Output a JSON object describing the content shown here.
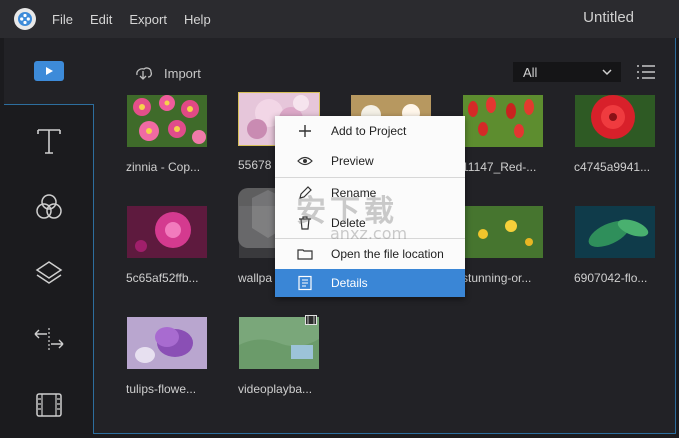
{
  "window": {
    "title": "Untitled"
  },
  "menu": [
    {
      "label": "File"
    },
    {
      "label": "Edit"
    },
    {
      "label": "Export"
    },
    {
      "label": "Help"
    }
  ],
  "sidebar": {
    "items": [
      {
        "icon": "media-icon",
        "active": true
      },
      {
        "icon": "text-icon"
      },
      {
        "icon": "filters-icon"
      },
      {
        "icon": "overlays-icon"
      },
      {
        "icon": "transitions-icon"
      },
      {
        "icon": "elements-icon"
      }
    ]
  },
  "toolbar": {
    "import_label": "Import",
    "filter_value": "All"
  },
  "media": [
    {
      "caption": "zinnia - Cop...",
      "scene": "pink-flowers"
    },
    {
      "caption": "55678",
      "scene": "pink-blossom",
      "selected": true
    },
    {
      "caption": "",
      "scene": "white-flowers"
    },
    {
      "caption": "11147_Red-...",
      "scene": "red-tulips"
    },
    {
      "caption": "c4745a9941...",
      "scene": "red-flower"
    },
    {
      "caption": "5c65af52ffb...",
      "scene": "purple-flower"
    },
    {
      "caption": "wallpa",
      "scene": "wallpaper"
    },
    {
      "caption": "",
      "scene": "hidden"
    },
    {
      "caption": "stunning-or...",
      "scene": "yellow-field"
    },
    {
      "caption": "6907042-flo...",
      "scene": "green-plant"
    },
    {
      "caption": "tulips-flowe...",
      "scene": "purple-tulips"
    },
    {
      "caption": "videoplayba...",
      "scene": "video-landscape",
      "video": true
    }
  ],
  "context_menu": {
    "items": [
      {
        "label": "Add to Project",
        "icon": "plus-icon"
      },
      {
        "label": "Preview",
        "icon": "eye-icon"
      },
      {
        "label": "Rename",
        "icon": "pencil-icon"
      },
      {
        "label": "Delete",
        "icon": "trash-icon"
      },
      {
        "label": "Open the file location",
        "icon": "folder-icon"
      },
      {
        "label": "Details",
        "icon": "list-icon",
        "highlighted": true
      }
    ]
  },
  "colors": {
    "accent": "#3a86d6",
    "selection_border": "#d7c05a",
    "border": "#2d6e9e"
  },
  "watermark": {
    "text": "安下载",
    "subtext": "anxz.com"
  }
}
